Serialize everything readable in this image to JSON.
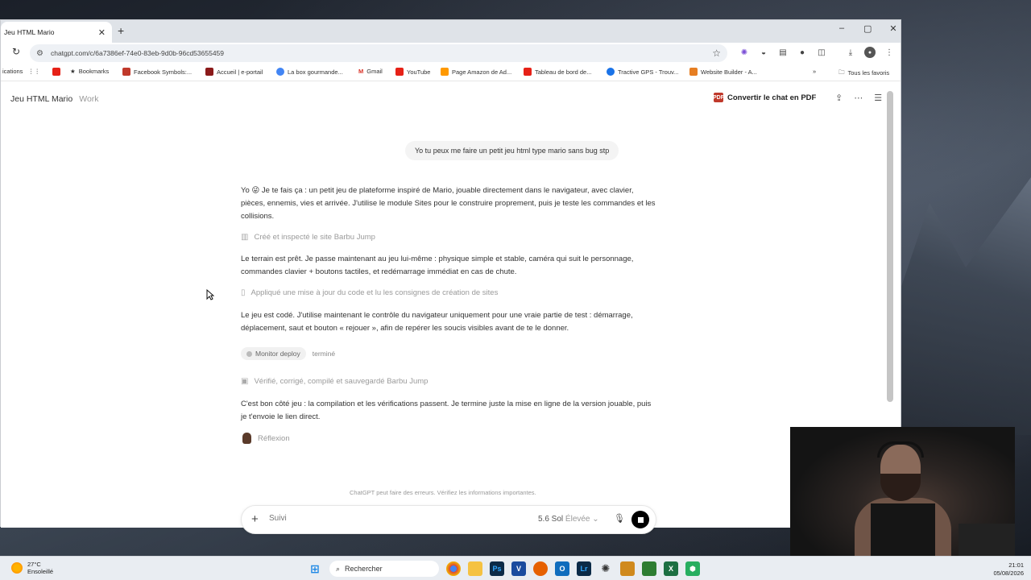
{
  "browser": {
    "tab_title": "Jeu HTML Mario",
    "tab_close": "✕",
    "new_tab": "+",
    "url": "chatgpt.com/c/6a7386ef-74e0-83eb-9d0b-96cd53655459",
    "window_controls": {
      "minimize": "–",
      "maximize": "▢",
      "close": "✕"
    }
  },
  "bookmarks": [
    {
      "label": "ications",
      "color": ""
    },
    {
      "label": "",
      "color": "#555555",
      "icon": "apps-grid-icon"
    },
    {
      "label": "",
      "color": "#e62117",
      "icon": "youtube-icon"
    },
    {
      "label": "Bookmarks",
      "color": "#333333",
      "icon": "star-icon"
    },
    {
      "label": "Facebook Symbols:...",
      "color": "#c0392b"
    },
    {
      "label": "Accueil | e-portail",
      "color": "#8b1a1a"
    },
    {
      "label": "La box gourmande...",
      "color": "#4285f4"
    },
    {
      "label": "Gmail",
      "color": "#d93025"
    },
    {
      "label": "YouTube",
      "color": "#e62117"
    },
    {
      "label": "Page Amazon de Ad...",
      "color": "#ff9900"
    },
    {
      "label": "Tableau de bord de...",
      "color": "#e62117"
    },
    {
      "label": "Tractive GPS - Trouv...",
      "color": "#1a73e8"
    },
    {
      "label": "Website Builder - A...",
      "color": "#e67e22"
    },
    {
      "label": "»",
      "color": ""
    },
    {
      "label": "Tous les favoris",
      "color": ""
    }
  ],
  "header": {
    "title": "Jeu HTML Mario",
    "project": "Work",
    "pdf_button": "Convertir le chat en PDF",
    "pdf_icon_text": "PDF"
  },
  "conversation": {
    "user_message": "Yo tu peux me faire un petit jeu html type mario sans bug stp",
    "assistant_1": "Yo 😜 Je te fais ça : un petit jeu de plateforme inspiré de Mario, jouable directement dans le navigateur, avec clavier, pièces, ennemis, vies et arrivée. J'utilise le module Sites pour le construire proprement, puis je teste les commandes et les collisions.",
    "step_1": "Créé et inspecté le site Barbu Jump",
    "assistant_2": "Le terrain est prêt. Je passe maintenant au jeu lui-même : physique simple et stable, caméra qui suit le personnage, commandes clavier + boutons tactiles, et redémarrage immédiat en cas de chute.",
    "step_2": "Appliqué une mise à jour du code et lu les consignes de création de sites",
    "assistant_3": "Le jeu est codé. J'utilise maintenant le contrôle du navigateur uniquement pour une vraie partie de test : démarrage, déplacement, saut et bouton « rejouer », afin de repérer les soucis visibles avant de te le donner.",
    "monitor_label": "Monitor deploy",
    "monitor_status": "terminé",
    "step_3": "Vérifié, corrigé, compilé et sauvegardé Barbu Jump",
    "assistant_4": "C'est bon côté jeu : la compilation et les vérifications passent. Je termine juste la mise en ligne de la version jouable, puis je t'envoie le lien direct.",
    "thinking": "Réflexion"
  },
  "disclaimer": "ChatGPT peut faire des erreurs. Vérifiez les informations importantes.",
  "composer": {
    "placeholder": "Suivi",
    "model": "5.6 Sol",
    "level": "Élevée"
  },
  "taskbar": {
    "temperature": "27°C",
    "weather": "Ensoleillé",
    "search": "Rechercher",
    "time": "21:01",
    "date": "05/08/2026"
  }
}
